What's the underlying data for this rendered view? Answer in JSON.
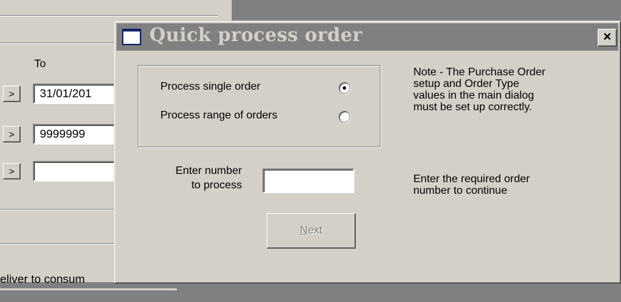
{
  "background": {
    "to_label": "To",
    "arrow_symbol": ">",
    "date_value": "31/01/201",
    "number_value": "9999999",
    "empty_value": "",
    "combo_text": "eliver to consum"
  },
  "dialog": {
    "title": "Quick process order",
    "close_symbol": "×",
    "options": [
      {
        "label": "Process single order",
        "selected": true
      },
      {
        "label": "Process range of orders",
        "selected": false
      }
    ],
    "note_lines": [
      "Note - The Purchase Order",
      "setup and Order Type",
      "values in the main dialog",
      "must be set up correctly."
    ],
    "number_label_lines": [
      "Enter number",
      "to process"
    ],
    "number_value": "",
    "hint_lines": [
      "Enter the required order",
      "number to continue"
    ],
    "next_mnemonic": "N",
    "next_rest": "ext"
  },
  "colors": {
    "face": "#d4d0c8",
    "inactive_title": "#808080",
    "workspace": "#808080"
  }
}
